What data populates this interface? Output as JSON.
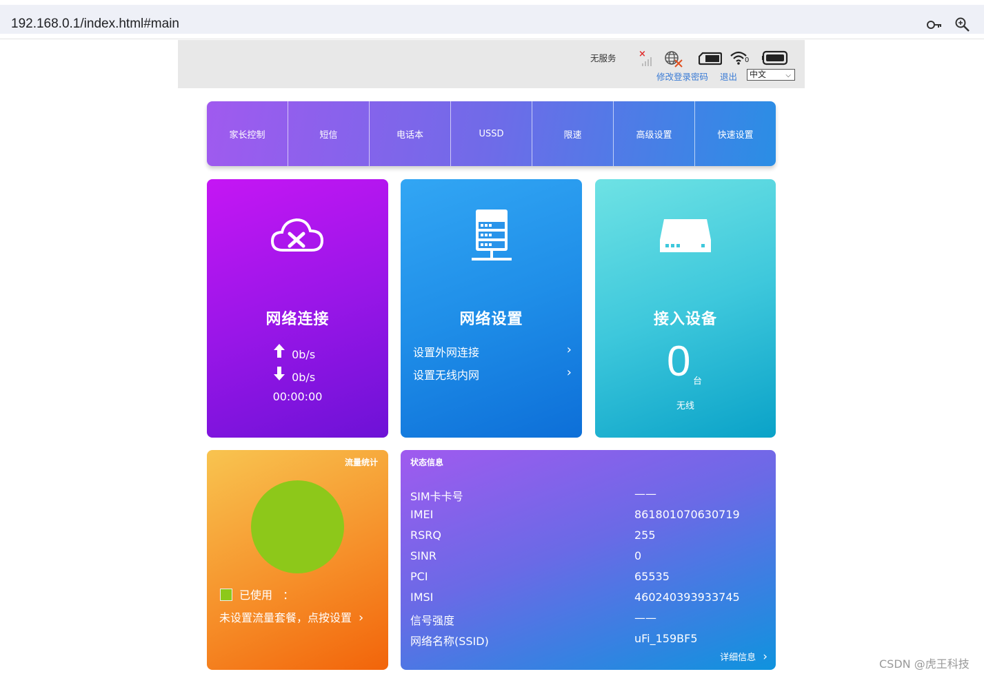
{
  "browser": {
    "url": "192.168.0.1/index.html#main",
    "icons": [
      "key-icon",
      "zoom-icon"
    ]
  },
  "header": {
    "network_status": "无服务",
    "links": {
      "change_password": "修改登录密码",
      "logout": "退出"
    },
    "language": "中文",
    "icons": [
      "no-signal-icon",
      "no-internet-globe-icon",
      "sim-card-icon",
      "wifi-icon",
      "battery-icon"
    ],
    "wifi_clients": "0"
  },
  "nav": {
    "items": [
      "家长控制",
      "短信",
      "电话本",
      "USSD",
      "限速",
      "高级设置",
      "快速设置"
    ]
  },
  "network_connection": {
    "title": "网络连接",
    "upload": "0b/s",
    "download": "0b/s",
    "duration": "00:00:00"
  },
  "network_settings": {
    "title": "网络设置",
    "links": [
      "设置外网连接",
      "设置无线内网"
    ]
  },
  "devices": {
    "title": "接入设备",
    "count": "0",
    "unit": "台",
    "type": "无线"
  },
  "traffic": {
    "title": "流量统计",
    "used_label": "已使用",
    "used_value": "：",
    "plan_prompt": "未设置流量套餐，点按设置",
    "used_color": "#8dc81a"
  },
  "status": {
    "title": "状态信息",
    "rows": [
      {
        "label": "SIM卡卡号",
        "value": "——"
      },
      {
        "label": "IMEI",
        "value": "861801070630719"
      },
      {
        "label": "RSRQ",
        "value": "255"
      },
      {
        "label": "SINR",
        "value": "0"
      },
      {
        "label": "PCI",
        "value": "65535"
      },
      {
        "label": "IMSI",
        "value": "460240393933745"
      },
      {
        "label": "信号强度",
        "value": "——"
      },
      {
        "label": "网络名称(SSID)",
        "value": "uFi_159BF5"
      }
    ],
    "more": "详细信息"
  },
  "watermark": "CSDN @虎王科技"
}
